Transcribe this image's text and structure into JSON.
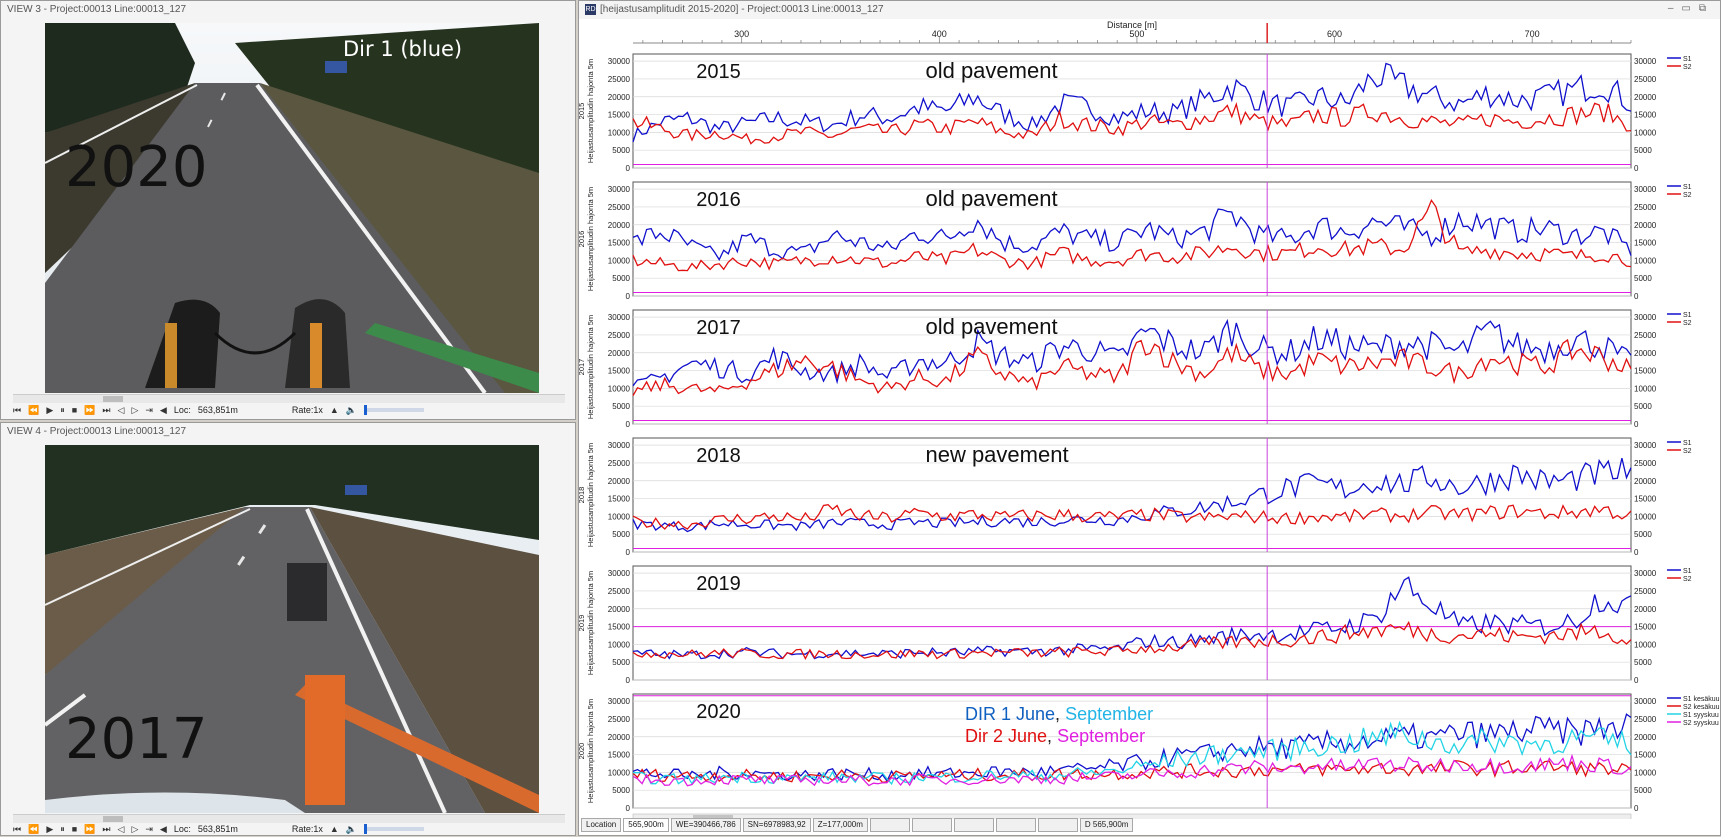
{
  "view3": {
    "title": "VIEW 3 - Project:00013 Line:00013_127",
    "year": "2020",
    "direction": "Dir 1 (blue)",
    "loc_label": "Loc:",
    "loc_value": "563,851m",
    "rate_label": "Rate:1x"
  },
  "view4": {
    "title": "VIEW 4 - Project:00013 Line:00013_127",
    "year": "2017",
    "loc_label": "Loc:",
    "loc_value": "563,851m",
    "rate_label": "Rate:1x"
  },
  "chart_window": {
    "title": "[heijastusamplitudit 2015-2020] - Project:00013 Line:00013_127",
    "app_icon": "RD",
    "x_axis_label": "Distance [m]",
    "x_ticks": [
      300,
      400,
      500,
      600,
      700
    ],
    "cursor_distance": 565.9,
    "y_axis_label": "Heijastusamplitudin hajonta 5m",
    "y_ticks": [
      0,
      5000,
      10000,
      15000,
      20000,
      25000,
      30000
    ],
    "x_range": [
      245,
      750
    ],
    "y_range": [
      0,
      32000
    ],
    "colors": {
      "s1": "#1010cc",
      "s2": "#e01010",
      "s1_sep": "#22d3e6",
      "s2_sep": "#e020e0",
      "cursor": "#cc44dd",
      "marker": "#dd2222"
    }
  },
  "chart_data": [
    {
      "type": "line",
      "year_axis": "2015",
      "annotation_year": "2015",
      "annotation_note": "old pavement",
      "series": [
        {
          "name": "S1",
          "values": [
            9000,
            13000,
            14000,
            11000,
            12500,
            14000,
            13000,
            12000,
            15000,
            14000,
            17000,
            16000,
            20000,
            15000,
            12000,
            18000,
            17000,
            14000,
            16000,
            15500,
            19000,
            23000,
            19000,
            17000,
            20000,
            18000,
            26000,
            23000,
            20000,
            18000,
            21000,
            19000,
            20000,
            22000,
            24000,
            18000
          ]
        },
        {
          "name": "S2",
          "values": [
            13000,
            11000,
            9000,
            10000,
            8000,
            9000,
            10000,
            9000,
            11000,
            10000,
            12000,
            11000,
            13000,
            10000,
            9000,
            14000,
            12000,
            11000,
            13000,
            12000,
            14000,
            16000,
            13000,
            12000,
            15000,
            14000,
            16000,
            14000,
            13000,
            12000,
            14000,
            13000,
            14000,
            15000,
            16000,
            12000
          ]
        }
      ]
    },
    {
      "type": "line",
      "year_axis": "2016",
      "annotation_year": "2016",
      "annotation_note": "old pavement",
      "series": [
        {
          "name": "S1",
          "values": [
            15000,
            18000,
            14000,
            11000,
            16000,
            13000,
            12000,
            17000,
            15000,
            13000,
            18000,
            16000,
            22000,
            15000,
            14000,
            18000,
            16000,
            15000,
            19000,
            16000,
            18000,
            23000,
            17000,
            16000,
            20000,
            18000,
            21000,
            19000,
            17000,
            22000,
            20000,
            18000,
            19000,
            17000,
            18000,
            13000
          ]
        },
        {
          "name": "S2",
          "values": [
            10000,
            9000,
            8000,
            9000,
            10000,
            9000,
            10000,
            11000,
            10000,
            9000,
            11000,
            10000,
            13000,
            10000,
            9000,
            12000,
            10000,
            10000,
            12000,
            11000,
            12000,
            14000,
            12000,
            12000,
            14000,
            13000,
            14000,
            13000,
            24000,
            12000,
            13000,
            12000,
            12000,
            11000,
            12000,
            10000
          ]
        }
      ]
    },
    {
      "type": "line",
      "year_axis": "2017",
      "annotation_year": "2017",
      "annotation_note": "old pavement",
      "series": [
        {
          "name": "S1",
          "values": [
            10000,
            13000,
            17000,
            16000,
            14000,
            19000,
            15000,
            14000,
            17000,
            13000,
            18000,
            17000,
            23000,
            19000,
            17000,
            22000,
            21000,
            18000,
            26000,
            22000,
            20000,
            27000,
            21000,
            20000,
            24000,
            22000,
            21000,
            23000,
            22000,
            20000,
            26000,
            22000,
            21000,
            24000,
            22000,
            17000
          ]
        },
        {
          "name": "S2",
          "values": [
            9000,
            11000,
            10000,
            9000,
            12000,
            15000,
            18000,
            16000,
            12000,
            10000,
            13000,
            12000,
            19000,
            14000,
            11000,
            16000,
            14000,
            13000,
            24000,
            17000,
            14000,
            20000,
            15000,
            14000,
            18000,
            16000,
            17000,
            18000,
            16000,
            14000,
            19000,
            17000,
            16000,
            21000,
            19000,
            15000
          ]
        }
      ]
    },
    {
      "type": "line",
      "year_axis": "2018",
      "annotation_year": "2018",
      "annotation_note": "new pavement",
      "series": [
        {
          "name": "S1",
          "values": [
            8000,
            7500,
            7000,
            8000,
            7800,
            7500,
            7200,
            8200,
            8000,
            7700,
            8300,
            8000,
            8500,
            8800,
            8400,
            9000,
            9200,
            9000,
            10500,
            11500,
            12500,
            14000,
            16000,
            18000,
            19000,
            17500,
            20000,
            19000,
            21000,
            18000,
            20000,
            22000,
            19500,
            20500,
            22000,
            22500
          ]
        },
        {
          "name": "S2",
          "values": [
            8500,
            8000,
            7800,
            9000,
            9500,
            10000,
            9200,
            12000,
            10000,
            9500,
            11000,
            10000,
            10500,
            9800,
            10200,
            10500,
            10000,
            9800,
            10500,
            10000,
            9500,
            10000,
            9800,
            9500,
            10000,
            9800,
            10500,
            10200,
            11000,
            10500,
            11000,
            11500,
            10800,
            11200,
            12000,
            10000
          ]
        }
      ]
    },
    {
      "type": "line",
      "year_axis": "2019",
      "annotation_year": "2019",
      "annotation_note": "",
      "series": [
        {
          "name": "S1",
          "values": [
            7500,
            7200,
            7000,
            7500,
            7800,
            7400,
            7300,
            7600,
            7500,
            7300,
            7800,
            7600,
            7900,
            8200,
            8000,
            8400,
            8600,
            8800,
            11000,
            10500,
            11500,
            12500,
            13000,
            12800,
            14000,
            15000,
            17000,
            27000,
            21000,
            15000,
            16000,
            15500,
            15000,
            16500,
            24000,
            20000
          ]
        },
        {
          "name": "S2",
          "values": [
            7800,
            7500,
            7200,
            7600,
            7400,
            7200,
            7300,
            7400,
            7200,
            7100,
            7500,
            7300,
            7600,
            7700,
            7500,
            7800,
            8000,
            8100,
            9000,
            9200,
            10000,
            10500,
            11000,
            11200,
            12000,
            13000,
            14000,
            14500,
            13000,
            12500,
            13000,
            12000,
            12500,
            13000,
            14000,
            11000
          ]
        }
      ]
    },
    {
      "type": "line",
      "year_axis": "2020",
      "annotation_year": "2020",
      "legend": [
        {
          "parts": [
            {
              "text": "DIR 1 June",
              "color": "#1060c0"
            },
            {
              "text": ", ",
              "color": "#222222"
            },
            {
              "text": "September",
              "color": "#22b4e6"
            }
          ]
        },
        {
          "parts": [
            {
              "text": "Dir 2 June",
              "color": "#e01010"
            },
            {
              "text": ", ",
              "color": "#222222"
            },
            {
              "text": "September",
              "color": "#e020e0"
            }
          ]
        }
      ],
      "series": [
        {
          "name": "S1 kesäkuu",
          "values": [
            10000,
            9500,
            9000,
            9800,
            10000,
            9400,
            9300,
            9600,
            9500,
            9300,
            9800,
            9600,
            9900,
            10200,
            10000,
            10400,
            11000,
            11800,
            13000,
            14500,
            15000,
            16500,
            17000,
            16800,
            18000,
            18500,
            19000,
            20000,
            19500,
            21000,
            20500,
            21500,
            22000,
            21000,
            22500,
            23000
          ]
        },
        {
          "name": "S2 kesäkuu",
          "values": [
            9500,
            9200,
            9000,
            9300,
            9100,
            9000,
            8900,
            9200,
            9000,
            8800,
            9100,
            9000,
            9300,
            9400,
            9200,
            9500,
            9600,
            9700,
            10000,
            10200,
            10500,
            10300,
            10800,
            10500,
            11000,
            10800,
            11200,
            11000,
            10800,
            11500,
            11000,
            11300,
            11600,
            11200,
            11000,
            10500
          ]
        },
        {
          "name": "S1 syyskuu",
          "values": [
            8500,
            8200,
            8000,
            8500,
            8800,
            8400,
            8300,
            8600,
            8500,
            8300,
            8800,
            8600,
            8900,
            9200,
            9000,
            9400,
            9800,
            10500,
            12000,
            13500,
            14500,
            15500,
            16000,
            16500,
            17500,
            18000,
            19500,
            21000,
            18500,
            18000,
            19000,
            18500,
            18000,
            19500,
            19000,
            18000
          ]
        },
        {
          "name": "S2 syyskuu",
          "values": [
            8000,
            7800,
            7600,
            8000,
            7900,
            7700,
            7800,
            7900,
            7700,
            7600,
            8000,
            7800,
            8100,
            8200,
            8000,
            8300,
            8500,
            8800,
            9500,
            9800,
            10500,
            11000,
            11500,
            11000,
            12000,
            11500,
            12500,
            12000,
            11800,
            12500,
            12000,
            11800,
            12200,
            12800,
            12000,
            11000
          ]
        }
      ]
    }
  ],
  "legend_labels": {
    "default": [
      "S1",
      "S2"
    ],
    "p2020": [
      "S1 kesäkuu",
      "S2 kesäkuu",
      "S1 syyskuu",
      "S2 syyskuu"
    ]
  },
  "statusbar": {
    "location_label": "Location",
    "location_value": "565,900m",
    "we": "WE=390466,786",
    "sn": "SN=6978983,92",
    "z": "Z=177,000m",
    "d": "D 565,900m"
  }
}
